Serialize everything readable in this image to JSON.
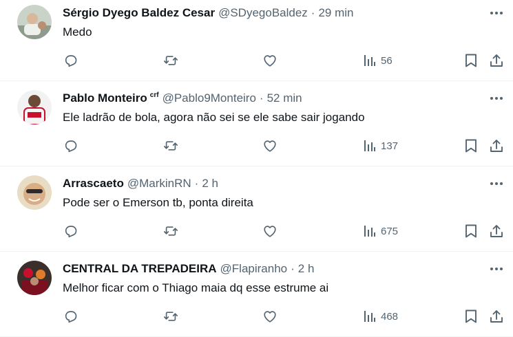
{
  "colors": {
    "text": "#0f1419",
    "muted": "#536471",
    "divider": "#eff3f4"
  },
  "icons": {
    "more": "ellipsis-icon",
    "reply": "reply-icon",
    "repost": "repost-icon",
    "like": "heart-icon",
    "views": "views-bar-chart-icon",
    "bookmark": "bookmark-icon",
    "share": "share-icon"
  },
  "tweets": [
    {
      "name": "Sérgio Dyego Baldez Cesar",
      "badge": "",
      "handle": "@SDyegoBaldez",
      "sep": "·",
      "time": "29 min",
      "text": "Medo",
      "views": "56"
    },
    {
      "name": "Pablo Monteiro",
      "badge": "crf",
      "handle": "@Pablo9Monteiro",
      "sep": "·",
      "time": "52 min",
      "text": "Ele ladrão de bola, agora não sei se ele sabe sair jogando",
      "views": "137"
    },
    {
      "name": "Arrascaeto",
      "badge": "",
      "handle": "@MarkinRN",
      "sep": "·",
      "time": "2 h",
      "text": "Pode ser o Emerson tb, ponta direita",
      "views": "675"
    },
    {
      "name": "CENTRAL DA TREPADEIRA",
      "badge": "",
      "handle": "@Flapiranho",
      "sep": "·",
      "time": "2 h",
      "text": "Melhor ficar com o Thiago maia dq esse estrume ai",
      "views": "468"
    }
  ]
}
